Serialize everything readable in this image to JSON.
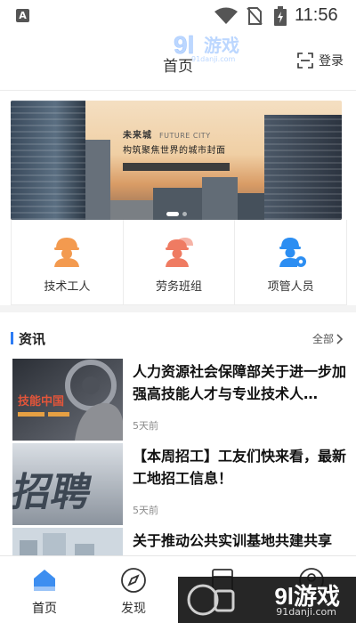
{
  "status_bar": {
    "time": "11:56",
    "app_badge": "A"
  },
  "header": {
    "title": "首页",
    "login_label": "登录"
  },
  "watermark": {
    "text": "9l游戏",
    "url": "91danji.com"
  },
  "banner": {
    "title": "未来城",
    "title_en": "FUTURE CITY",
    "subtitle": "构筑聚焦世界的城市封面",
    "slide_count": 2,
    "active_slide": 1
  },
  "categories": [
    {
      "label": "技术工人",
      "icon": "worker-helmet-icon",
      "color": "#f39a4f"
    },
    {
      "label": "劳务班组",
      "icon": "team-helmet-icon",
      "color": "#ef7b62"
    },
    {
      "label": "项管人员",
      "icon": "manager-gear-icon",
      "color": "#2c8ef2"
    }
  ],
  "news": {
    "section_title": "资讯",
    "all_label": "全部",
    "articles": [
      {
        "title": "人力资源社会保障部关于进一步加强高技能人才与专业技术人…",
        "time": "5天前",
        "thumb_text": "技能中国"
      },
      {
        "title": "【本周招工】工友们快来看，最新工地招工信息！",
        "time": "5天前",
        "thumb_text": "招聘"
      },
      {
        "title": "关于推动公共实训基地共建共享",
        "time": ""
      }
    ]
  },
  "tabs": [
    {
      "label": "首页",
      "icon": "home-icon",
      "active": true
    },
    {
      "label": "发现",
      "icon": "compass-icon",
      "active": false
    },
    {
      "label": "",
      "icon": "building-icon",
      "active": false
    },
    {
      "label": "",
      "icon": "profile-icon",
      "active": false
    }
  ],
  "colors": {
    "accent": "#2d7cf5",
    "tab_active": "#3d8ef0"
  }
}
